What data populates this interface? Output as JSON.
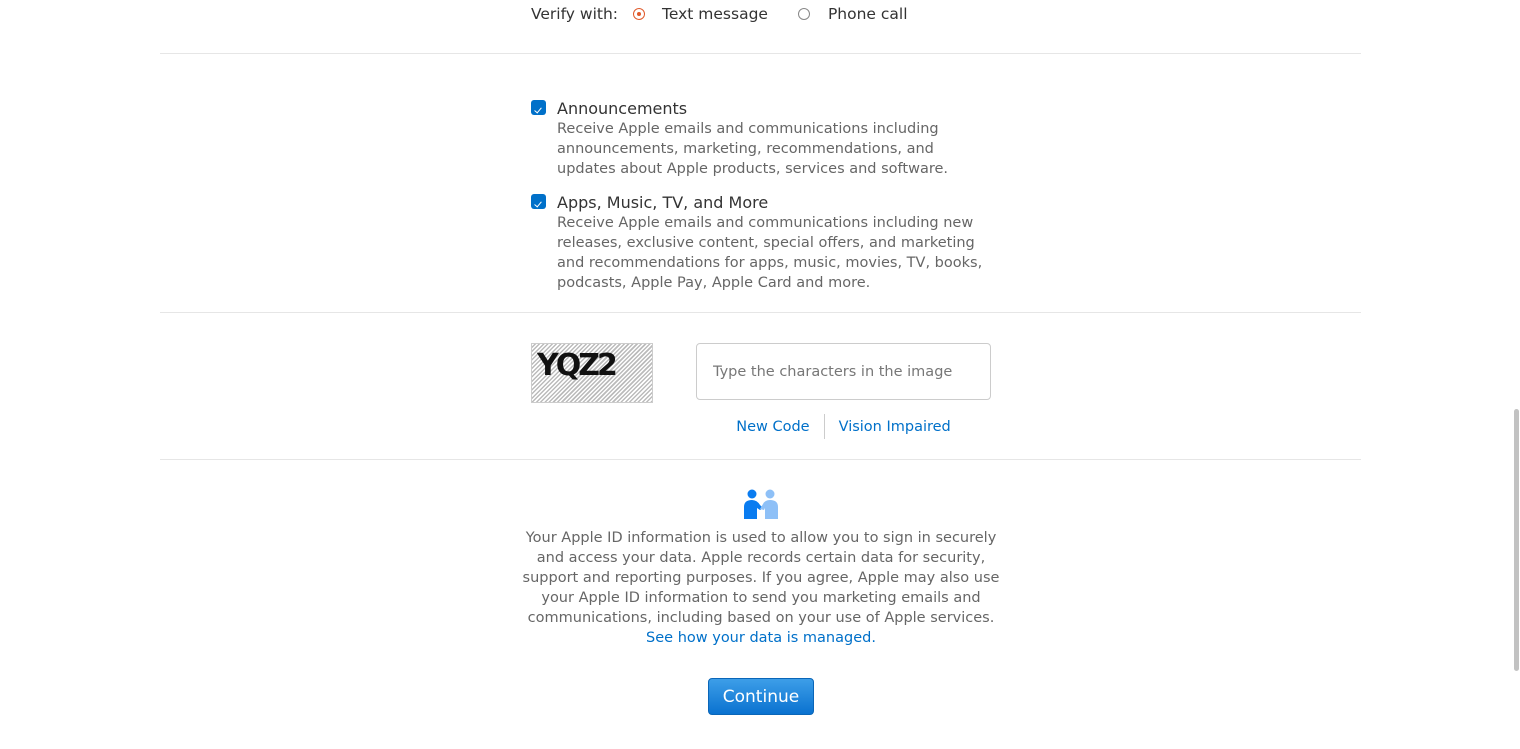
{
  "verify": {
    "label": "Verify with:",
    "options": [
      {
        "label": "Text message",
        "selected": true
      },
      {
        "label": "Phone call",
        "selected": false
      }
    ]
  },
  "subscriptions": [
    {
      "title": "Announcements",
      "checked": true,
      "description": "Receive Apple emails and communications including announcements, marketing, recommendations, and updates about Apple products, services and software."
    },
    {
      "title": "Apps, Music, TV, and More",
      "checked": true,
      "description": "Receive Apple emails and communications including new releases, exclusive content, special offers, and marketing and recommendations for apps, music, movies, TV, books, podcasts, Apple Pay, Apple Card and more."
    }
  ],
  "captcha": {
    "image_text": "YQZ2",
    "input_placeholder": "Type the characters in the image",
    "input_value": "",
    "new_code_label": "New Code",
    "vision_impaired_label": "Vision Impaired"
  },
  "privacy": {
    "icon": "handshake-people-icon",
    "text": "Your Apple ID information is used to allow you to sign in securely and access your data. Apple records certain data for security, support and reporting purposes. If you agree, Apple may also use your Apple ID information to send you marketing emails and communications, including based on your use of Apple services.",
    "link_label": "See how your data is managed."
  },
  "continue_label": "Continue",
  "colors": {
    "accent": "#0070c9",
    "radio_selected": "#e05a2b"
  }
}
